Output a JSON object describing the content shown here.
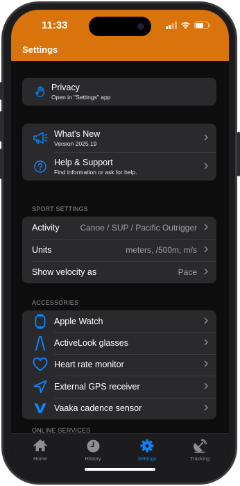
{
  "status": {
    "time": "11:33"
  },
  "header": {
    "title": "Settings"
  },
  "privacy": {
    "title": "Privacy",
    "subtitle": "Open in \"Settings\" app",
    "icon": "hand-icon"
  },
  "info": [
    {
      "title": "What's New",
      "subtitle": "Version 2025.19",
      "icon": "megaphone-icon"
    },
    {
      "title": "Help & Support",
      "subtitle": "Find information or ask for help.",
      "icon": "question-circle-icon"
    }
  ],
  "sport": {
    "header": "SPORT SETTINGS",
    "rows": [
      {
        "label": "Activity",
        "value": "Canoe / SUP / Pacific Outrigger"
      },
      {
        "label": "Units",
        "value": "meters, /500m, m/s"
      },
      {
        "label": "Show velocity as",
        "value": "Pace"
      }
    ]
  },
  "accessories": {
    "header": "ACCESSORIES",
    "rows": [
      {
        "label": "Apple Watch",
        "icon": "watch-icon"
      },
      {
        "label": "ActiveLook glasses",
        "icon": "activelook-icon"
      },
      {
        "label": "Heart rate monitor",
        "icon": "heart-icon"
      },
      {
        "label": "External GPS receiver",
        "icon": "location-arrow-icon"
      },
      {
        "label": "Vaaka cadence sensor",
        "icon": "vaaka-icon"
      }
    ]
  },
  "online": {
    "header": "ONLINE SERVICES"
  },
  "tabs": [
    {
      "label": "Home",
      "icon": "home-icon",
      "active": false
    },
    {
      "label": "History",
      "icon": "clock-icon",
      "active": false
    },
    {
      "label": "Settings",
      "icon": "gear-icon",
      "active": true
    },
    {
      "label": "Tracking",
      "icon": "satellite-icon",
      "active": false
    }
  ],
  "colors": {
    "accent": "#0a84ff",
    "header": "#d9740c",
    "cell": "#2a2a2c",
    "background": "#0d0d0d"
  }
}
